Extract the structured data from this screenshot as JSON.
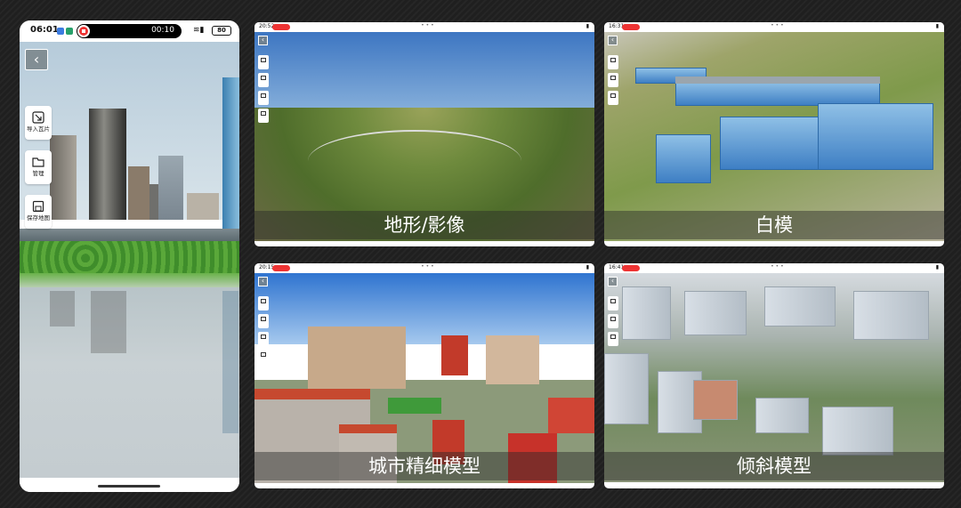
{
  "phone": {
    "status": {
      "time": "06:01",
      "timer": "00:10",
      "battery": "80"
    },
    "back_icon": "back-arrow-icon",
    "tools": [
      {
        "label": "导入瓦片",
        "icon": "import-tiles-icon"
      },
      {
        "label": "管理",
        "icon": "folder-icon"
      },
      {
        "label": "保存地图",
        "icon": "save-icon"
      }
    ]
  },
  "cards": [
    {
      "caption": "地形/影像",
      "status_time": "20:52",
      "scene": "terrain"
    },
    {
      "caption": "白模",
      "status_time": "16:31",
      "scene": "white-model"
    },
    {
      "caption": "城市精细模型",
      "status_time": "20:15",
      "scene": "city-fine-model"
    },
    {
      "caption": "倾斜模型",
      "status_time": "16:41",
      "scene": "oblique-model"
    }
  ],
  "colors": {
    "background": "#222222",
    "caption_bg": "rgba(40,40,40,0.45)",
    "record": "#ee3333"
  }
}
